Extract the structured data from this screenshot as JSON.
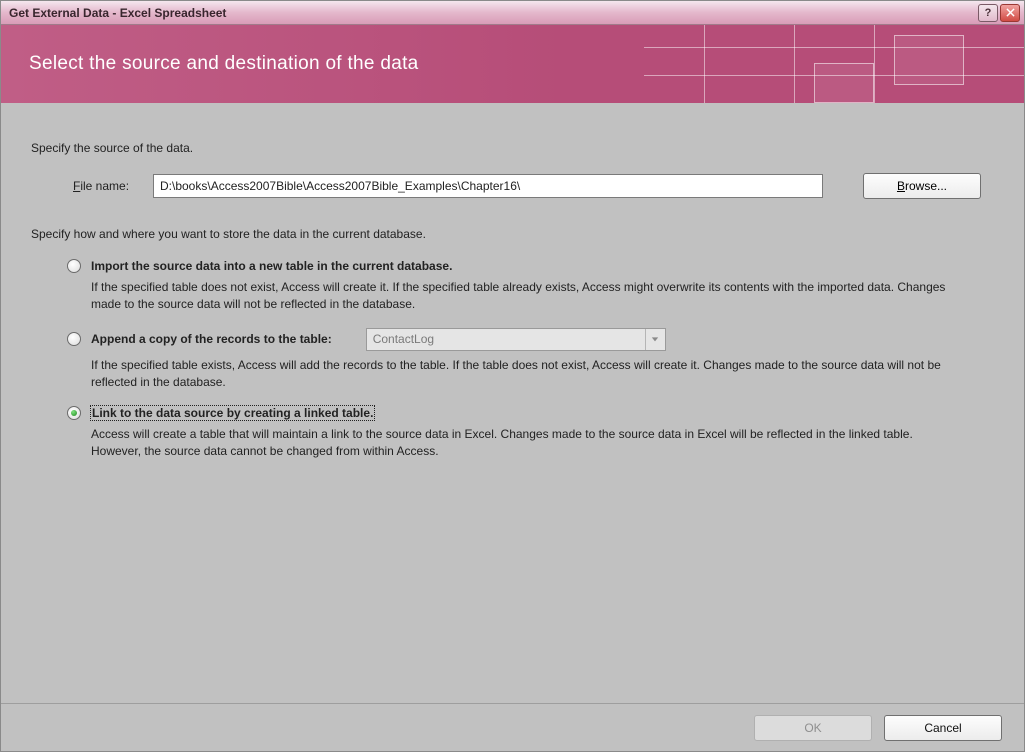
{
  "window": {
    "title": "Get External Data - Excel Spreadsheet"
  },
  "banner": {
    "title": "Select the source and destination of the data"
  },
  "source": {
    "label": "Specify the source of the data.",
    "file_label_pre": "F",
    "file_label_post": "ile name:",
    "file_value": "D:\\books\\Access2007Bible\\Access2007Bible_Examples\\Chapter16\\",
    "browse_pre": "B",
    "browse_post": "rowse..."
  },
  "store": {
    "label": "Specify how and where you want to store the data in the current database."
  },
  "options": {
    "import": {
      "title": "Import the source data into a new table in the current database.",
      "desc": "If the specified table does not exist, Access will create it. If the specified table already exists, Access might overwrite its contents with the imported data. Changes made to the source data will not be reflected in the database."
    },
    "append": {
      "title": "Append a copy of the records to the table:",
      "combo_value": "ContactLog",
      "desc": "If the specified table exists, Access will add the records to the table. If the table does not exist, Access will create it. Changes made to the source data will not be reflected in the database."
    },
    "link": {
      "title": "Link to the data source by creating a linked table.",
      "desc": "Access will create a table that will maintain a link to the source data in Excel. Changes made to the source data in Excel will be reflected in the linked table. However, the source data cannot be changed from within Access."
    },
    "selected": "link"
  },
  "footer": {
    "ok": "OK",
    "cancel": "Cancel"
  }
}
